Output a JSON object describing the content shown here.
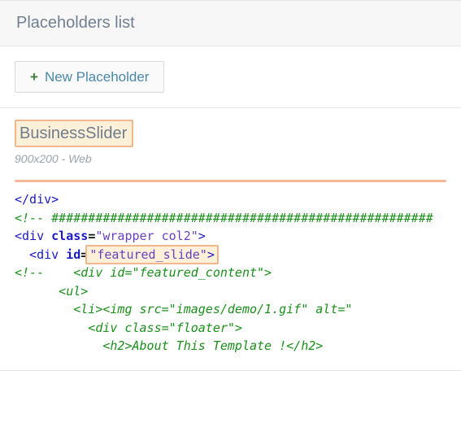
{
  "header": {
    "title": "Placeholders list"
  },
  "toolbar": {
    "new_label": "New Placeholder"
  },
  "item": {
    "title": "BusinessSlider",
    "meta": "900x200 - Web"
  },
  "code": {
    "l1_close_div": "</div>",
    "hash_row": "<!-- ####################################################",
    "wrapper_open_a": "<div ",
    "wrapper_class_k": "class",
    "wrapper_class_v": "\"wrapper col2\"",
    "wrapper_open_b": ">",
    "featured_open_a": "  <div ",
    "featured_id_k": "id",
    "featured_id_v": "\"featured_slide\"",
    "featured_open_b": ">",
    "comment_open": "<!--",
    "comment_body": "    <div id=\"featured_content\">",
    "ul_open": "      <ul>",
    "li_img": "        <li><img src=\"images/demo/1.gif\" alt=\"",
    "floater": "          <div class=\"floater\">",
    "h2": "            <h2>About This Template !</h2>"
  }
}
